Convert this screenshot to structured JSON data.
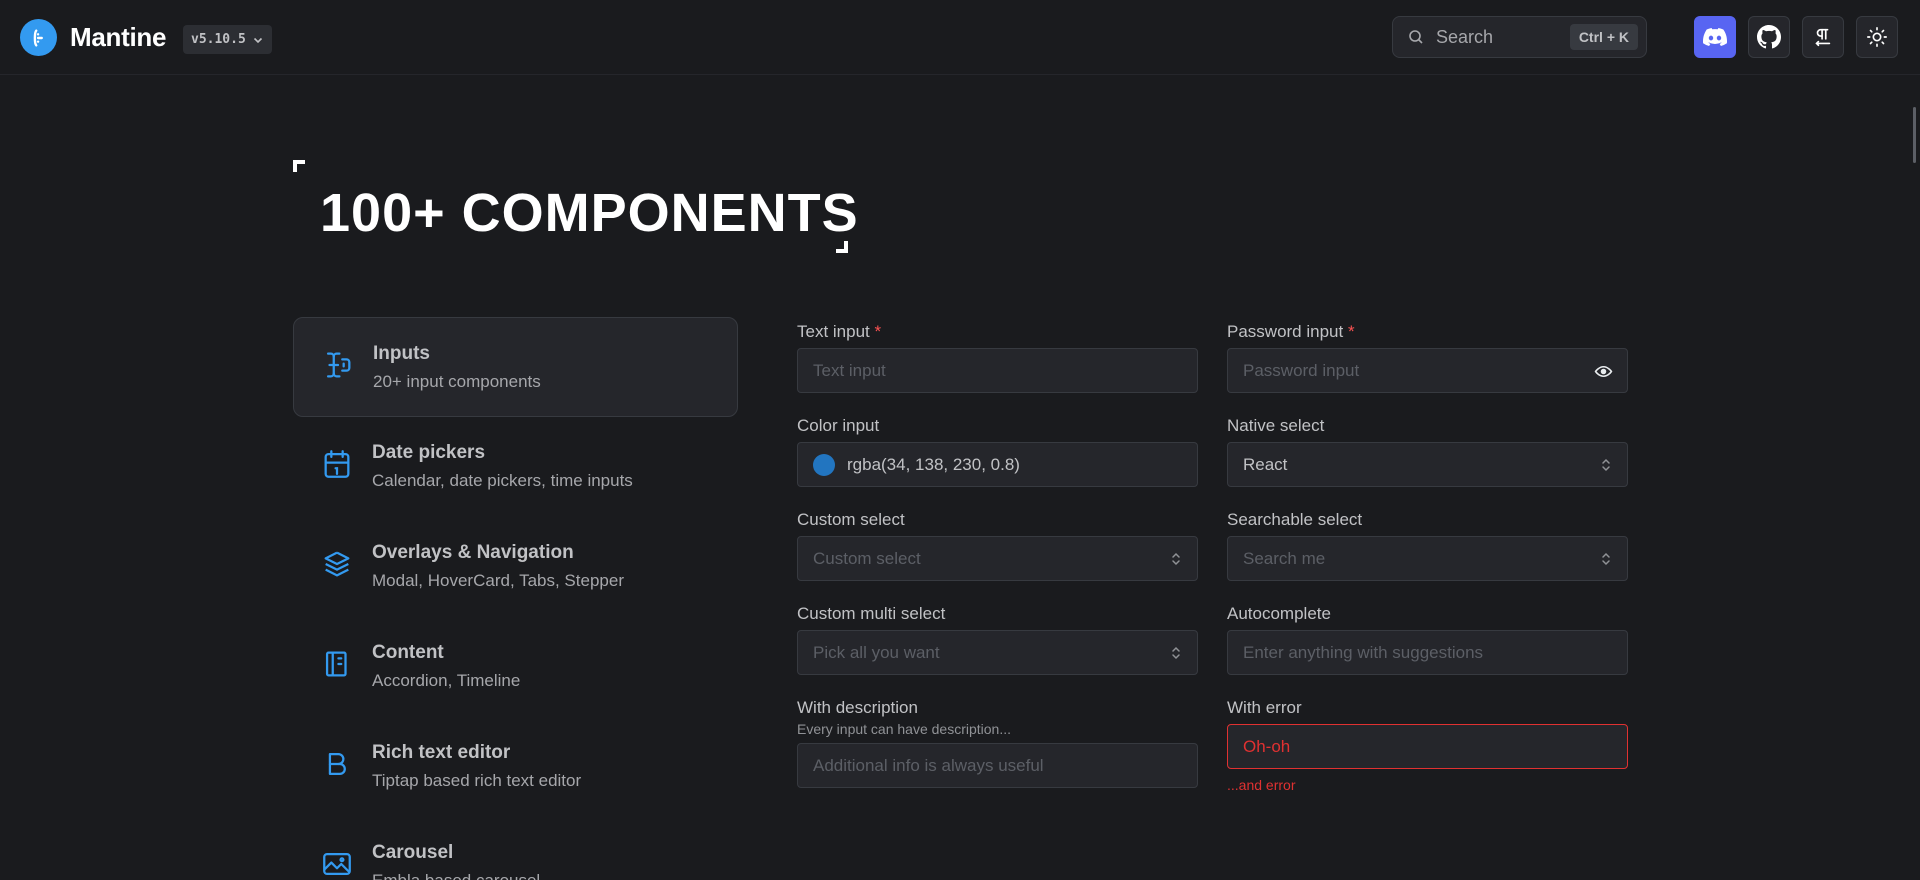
{
  "header": {
    "brand": "Mantine",
    "version": "v5.10.5",
    "search": {
      "label": "Search",
      "shortcut": "Ctrl + K"
    },
    "buttons": [
      {
        "name": "discord",
        "icon": "discord-icon",
        "color": "#5865f2"
      },
      {
        "name": "github",
        "icon": "github-icon"
      },
      {
        "name": "text-direction",
        "icon": "pilcrow-icon"
      },
      {
        "name": "theme",
        "icon": "sun-icon"
      }
    ]
  },
  "hero": {
    "title": "100+ COMPONENTS"
  },
  "categories": [
    {
      "title": "Inputs",
      "desc": "20+ input components",
      "icon": "input-cursor-icon",
      "active": true
    },
    {
      "title": "Date pickers",
      "desc": "Calendar, date pickers, time inputs",
      "icon": "calendar-icon"
    },
    {
      "title": "Overlays & Navigation",
      "desc": "Modal, HoverCard, Tabs, Stepper",
      "icon": "layers-icon"
    },
    {
      "title": "Content",
      "desc": "Accordion, Timeline",
      "icon": "notebook-icon"
    },
    {
      "title": "Rich text editor",
      "desc": "Tiptap based rich text editor",
      "icon": "bold-icon"
    },
    {
      "title": "Carousel",
      "desc": "Embla based carousel",
      "icon": "photo-icon"
    }
  ],
  "form": {
    "text_input": {
      "label": "Text input",
      "required": "*",
      "placeholder": "Text input"
    },
    "password_input": {
      "label": "Password input",
      "required": "*",
      "placeholder": "Password input"
    },
    "color_input": {
      "label": "Color input",
      "value": "rgba(34, 138, 230, 0.8)"
    },
    "native_select": {
      "label": "Native select",
      "value": "React"
    },
    "custom_select": {
      "label": "Custom select",
      "placeholder": "Custom select"
    },
    "searchable_select": {
      "label": "Searchable select",
      "placeholder": "Search me"
    },
    "multi_select": {
      "label": "Custom multi select",
      "placeholder": "Pick all you want"
    },
    "autocomplete": {
      "label": "Autocomplete",
      "placeholder": "Enter anything with suggestions"
    },
    "with_description": {
      "label": "With description",
      "description": "Every input can have description...",
      "placeholder": "Additional info is always useful"
    },
    "with_error": {
      "label": "With error",
      "value": "Oh-oh",
      "error": "...and error"
    }
  },
  "colors": {
    "accent": "#339af0",
    "error": "#e03131",
    "background": "#1a1b1e"
  }
}
